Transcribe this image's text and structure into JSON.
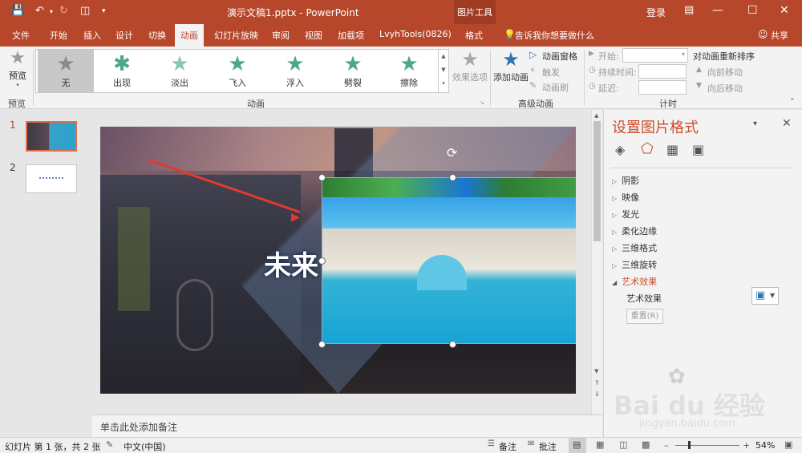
{
  "app": {
    "document_title": "演示文稿1.pptx - PowerPoint",
    "context_tool_group": "图片工具",
    "login": "登录",
    "share": "共享",
    "tell_me": "告诉我你想要做什么"
  },
  "tabs": [
    "文件",
    "开始",
    "插入",
    "设计",
    "切换",
    "动画",
    "幻灯片放映",
    "审阅",
    "视图",
    "加载项",
    "LvyhTools(0826)",
    "格式"
  ],
  "ribbon": {
    "preview_label": "预览",
    "preview_group": "预览",
    "animations_group": "动画",
    "animations": [
      "无",
      "出现",
      "淡出",
      "飞入",
      "浮入",
      "劈裂",
      "擦除"
    ],
    "effect_options": "效果选项",
    "add_animation": "添加动画",
    "animation_pane": "动画窗格",
    "trigger": "触发",
    "animation_painter": "动画刷",
    "advanced_group": "高级动画",
    "start_label": "开始:",
    "duration_label": "持续时间:",
    "delay_label": "延迟:",
    "timing_group": "计时",
    "reorder_title": "对动画重新排序",
    "move_earlier": "向前移动",
    "move_later": "向后移动"
  },
  "thumbnails": [
    {
      "number": "1",
      "selected": true
    },
    {
      "number": "2",
      "selected": false
    }
  ],
  "slide": {
    "title_text": "未来"
  },
  "notes_placeholder": "单击此处添加备注",
  "format_pane": {
    "title": "设置图片格式",
    "icons": [
      "fill-icon",
      "effects-icon",
      "size-icon",
      "picture-icon"
    ],
    "sections": [
      "阴影",
      "映像",
      "发光",
      "柔化边缘",
      "三维格式",
      "三维旋转",
      "艺术效果"
    ],
    "expanded_section": "艺术效果",
    "artistic_label": "艺术效果",
    "reset_button": "重置(R)"
  },
  "status": {
    "slide_info": "幻灯片 第 1 张，共 2 张",
    "language": "中文(中国)",
    "notes": "备注",
    "comments": "批注",
    "zoom": "54%"
  },
  "watermark": {
    "text": "Bai du 经验",
    "url": "jingyan.baidu.com"
  },
  "colors": {
    "accent": "#b7472a",
    "pane_title": "#d04a2a",
    "gallery_star": "#4aa987"
  }
}
